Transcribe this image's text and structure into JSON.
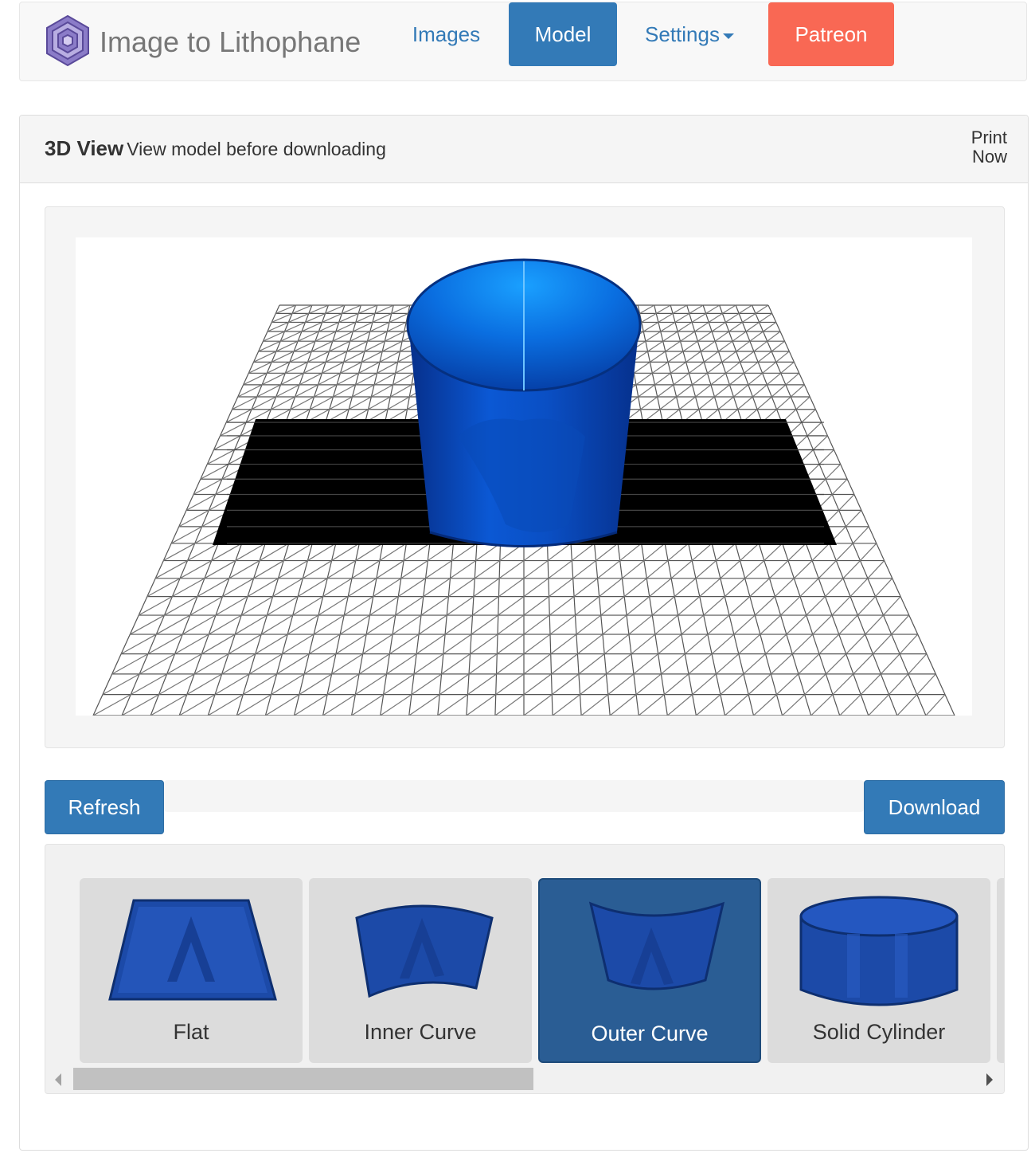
{
  "nav": {
    "brand": "Image to Lithophane",
    "links": [
      "Images",
      "Model",
      "Settings",
      "Patreon"
    ],
    "active": "Model",
    "colors": {
      "primary": "#337ab7",
      "patreon": "#f96854"
    }
  },
  "panel": {
    "title": "3D View",
    "subtitle": "View model before downloading",
    "print_line1": "Print",
    "print_line2": "Now"
  },
  "actions": {
    "refresh": "Refresh",
    "download": "Download"
  },
  "shapes": {
    "items": [
      "Flat",
      "Inner Curve",
      "Outer Curve",
      "Solid Cylinder"
    ],
    "selected": "Outer Curve"
  },
  "model": {
    "color": "#0a4fc4",
    "shape": "outer-curve"
  }
}
